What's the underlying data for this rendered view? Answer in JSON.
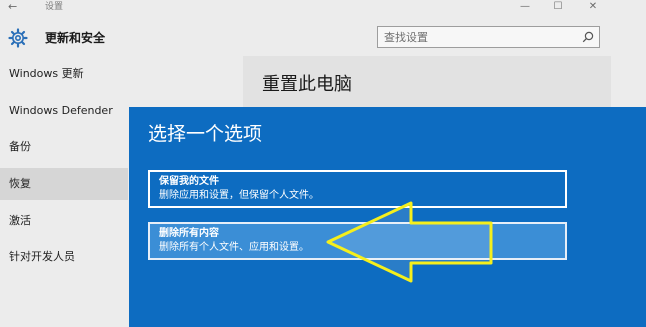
{
  "window": {
    "title": "设置",
    "back_glyph": "←",
    "min_glyph": "—",
    "max_glyph": "☐",
    "close_glyph": "✕"
  },
  "header": {
    "title": "更新和安全"
  },
  "search": {
    "placeholder": "查找设置"
  },
  "sidebar": {
    "items": [
      {
        "label": "Windows 更新"
      },
      {
        "label": "Windows Defender"
      },
      {
        "label": "备份"
      },
      {
        "label": "恢复",
        "active": true
      },
      {
        "label": "激活"
      },
      {
        "label": "针对开发人员"
      }
    ]
  },
  "content": {
    "title": "重置此电脑"
  },
  "dialog": {
    "title": "选择一个选项",
    "options": [
      {
        "title": "保留我的文件",
        "description": "删除应用和设置，但保留个人文件。"
      },
      {
        "title": "删除所有内容",
        "description": "删除所有个人文件、应用和设置。"
      }
    ]
  },
  "annotation": {
    "arrow_color": "#f5ef1c",
    "icon": "arrow-left-icon"
  },
  "colors": {
    "dialog_bg": "#0d6cc1",
    "selected_option_bg": "#3b8ed6",
    "window_bg": "#ececec"
  }
}
